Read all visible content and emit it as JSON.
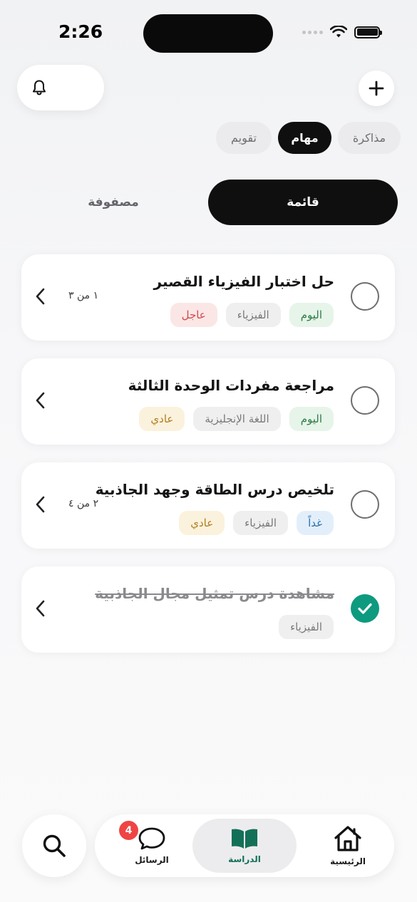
{
  "status_bar": {
    "time": "2:26"
  },
  "segments": [
    {
      "label": "مذاكرة",
      "active": false
    },
    {
      "label": "مهام",
      "active": true
    },
    {
      "label": "تقويم",
      "active": false
    }
  ],
  "view_toggle": {
    "list_label": "قائمة",
    "matrix_label": "مصفوفة",
    "active": "list"
  },
  "tasks": [
    {
      "title": "حل اختبار الفيزياء القصير",
      "done": false,
      "count": "١ من ٣",
      "tags": [
        {
          "label": "اليوم",
          "color": "#2a7b43"
        },
        {
          "label": "الفيزياء",
          "color": "#7a7a7d"
        },
        {
          "label": "عاجل",
          "color": "#d2494a"
        }
      ]
    },
    {
      "title": "مراجعة مفردات الوحدة الثالثة",
      "done": false,
      "count": "",
      "tags": [
        {
          "label": "اليوم",
          "color": "#2a7b43"
        },
        {
          "label": "اللغة الإنجليزية",
          "color": "#7a7a7d"
        },
        {
          "label": "عادي",
          "color": "#b07d1e"
        }
      ]
    },
    {
      "title": "تلخيص درس الطاقة وجهد الجاذبية",
      "done": false,
      "count": "٢ من ٤",
      "tags": [
        {
          "label": "غداً",
          "color": "#2c6ea8"
        },
        {
          "label": "الفيزياء",
          "color": "#7a7a7d"
        },
        {
          "label": "عادي",
          "color": "#b07d1e"
        }
      ]
    },
    {
      "title": "مشاهدة درس تمثيل مجال الجاذبية",
      "done": true,
      "count": "",
      "tags": [
        {
          "label": "الفيزياء",
          "color": "#7a7a7d"
        }
      ]
    }
  ],
  "bottom_nav": {
    "home_label": "الرئيسية",
    "study_label": "الدراسة",
    "messages_label": "الرسائل",
    "messages_badge": "4",
    "active": "study"
  },
  "icons": [
    "bell-icon",
    "plus-icon",
    "chevron-left-icon",
    "checkmark-icon",
    "search-icon",
    "home-icon",
    "book-icon",
    "chat-bubble-icon"
  ],
  "accent_color": "#0e9a7f"
}
